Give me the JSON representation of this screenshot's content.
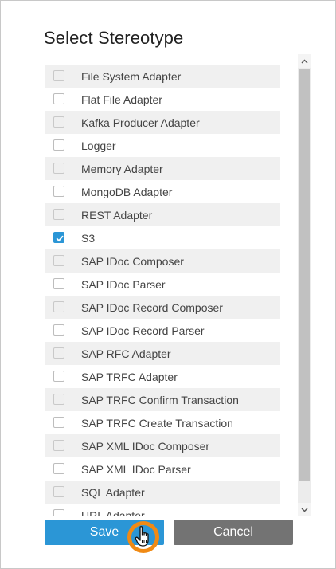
{
  "dialog": {
    "title": "Select Stereotype"
  },
  "stereotypes": [
    {
      "label": "File System Adapter",
      "checked": false
    },
    {
      "label": "Flat File Adapter",
      "checked": false
    },
    {
      "label": "Kafka Producer Adapter",
      "checked": false
    },
    {
      "label": "Logger",
      "checked": false
    },
    {
      "label": "Memory Adapter",
      "checked": false
    },
    {
      "label": "MongoDB Adapter",
      "checked": false
    },
    {
      "label": "REST Adapter",
      "checked": false
    },
    {
      "label": "S3",
      "checked": true
    },
    {
      "label": "SAP IDoc Composer",
      "checked": false
    },
    {
      "label": "SAP IDoc Parser",
      "checked": false
    },
    {
      "label": "SAP IDoc Record Composer",
      "checked": false
    },
    {
      "label": "SAP IDoc Record Parser",
      "checked": false
    },
    {
      "label": "SAP RFC Adapter",
      "checked": false
    },
    {
      "label": "SAP TRFC Adapter",
      "checked": false
    },
    {
      "label": "SAP TRFC Confirm Transaction",
      "checked": false
    },
    {
      "label": "SAP TRFC Create Transaction",
      "checked": false
    },
    {
      "label": "SAP XML IDoc Composer",
      "checked": false
    },
    {
      "label": "SAP XML IDoc Parser",
      "checked": false
    },
    {
      "label": "SQL Adapter",
      "checked": false
    },
    {
      "label": "URL Adapter",
      "checked": false
    }
  ],
  "buttons": {
    "save_label": "Save",
    "cancel_label": "Cancel"
  },
  "icons": {
    "checkmark": "check-icon",
    "scroll_up": "chevron-up-icon",
    "scroll_down": "chevron-down-icon",
    "cursor": "hand-pointer-icon"
  },
  "colors": {
    "accent": "#2b96d6",
    "cancel": "#737373",
    "highlight_ring": "#f08a14",
    "row_alt": "#f0f0f0"
  }
}
